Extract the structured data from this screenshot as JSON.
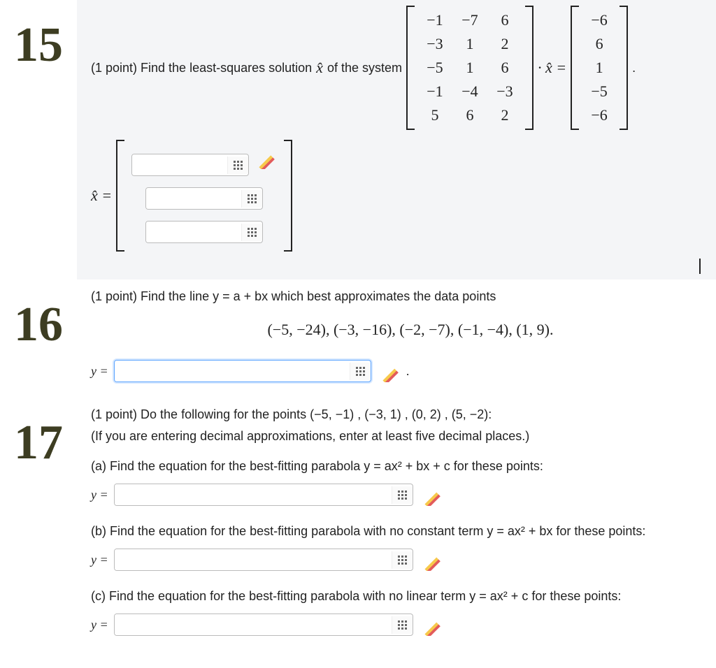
{
  "problems": {
    "p15": {
      "number_label": "15",
      "prompt_prefix": "(1 point) Find the least-squares solution ",
      "prompt_mid": " of the system",
      "xhat_symbol": "x̂",
      "matrix_A": [
        [
          "−1",
          "−7",
          "6"
        ],
        [
          "−3",
          "1",
          "2"
        ],
        [
          "−5",
          "1",
          "6"
        ],
        [
          "−1",
          "−4",
          "−3"
        ],
        [
          "5",
          "6",
          "2"
        ]
      ],
      "dot_xhat_eq": "· x̂ =",
      "vector_b": [
        "−6",
        "6",
        "1",
        "−5",
        "−6"
      ],
      "trailing_period": ".",
      "answer_label": "x̂ =",
      "answer_rows": 3
    },
    "p16": {
      "number_label": "16",
      "prompt_line": "(1 point) Find the line y = a + bx which best approximates the data points",
      "data_points": "(−5, −24), (−3, −16), (−2, −7), (−1, −4), (1, 9).",
      "answer_label": "y =",
      "answer_trailing": "."
    },
    "p17": {
      "number_label": "17",
      "prompt_line1": "(1 point) Do the following for the points (−5, −1) , (−3, 1) , (0, 2) , (5, −2):",
      "prompt_line2": "(If you are entering decimal approximations, enter at least five decimal places.)",
      "parts": {
        "a": {
          "question": "(a) Find the equation for the best-fitting parabola y = ax² + bx + c for these points:",
          "answer_label": "y ="
        },
        "b": {
          "question": "(b) Find the equation for the best-fitting parabola with no constant term y = ax² + bx for these points:",
          "answer_label": "y ="
        },
        "c": {
          "question": "(c) Find the equation for the best-fitting parabola with no linear term y = ax² + c for these points:",
          "answer_label": "y ="
        }
      }
    }
  }
}
